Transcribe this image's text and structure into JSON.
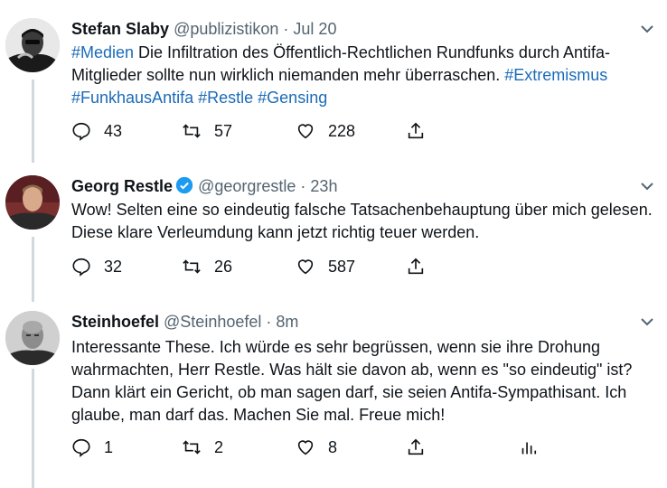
{
  "tweets": [
    {
      "name": "Stefan Slaby",
      "handle": "@publizistikon",
      "sep": "·",
      "time": "Jul 20",
      "text": [
        {
          "t": "#Medien",
          "tag": true
        },
        {
          "t": " Die Infiltration des Öffentlich-Rechtlichen Rundfunks durch Antifa-Mitglieder sollte nun wirklich niemanden mehr überraschen. ",
          "tag": false
        },
        {
          "t": "#Extremismus",
          "tag": true
        },
        {
          "t": " ",
          "tag": false
        },
        {
          "t": "#FunkhausAntifa",
          "tag": true
        },
        {
          "t": " ",
          "tag": false
        },
        {
          "t": "#Restle",
          "tag": true
        },
        {
          "t": " ",
          "tag": false
        },
        {
          "t": "#Gensing",
          "tag": true
        }
      ],
      "replies": "43",
      "retweets": "57",
      "likes": "228"
    },
    {
      "name": "Georg Restle",
      "handle": "@georgrestle",
      "sep": "·",
      "time": "23h",
      "verified": true,
      "text_plain": "Wow! Selten eine so eindeutig falsche Tatsachenbehauptung über mich gelesen. Diese klare Verleumdung kann jetzt richtig teuer werden.",
      "replies": "32",
      "retweets": "26",
      "likes": "587"
    },
    {
      "name": "Steinhoefel",
      "handle": "@Steinhoefel",
      "sep": "·",
      "time": "8m",
      "text_plain": "Interessante These. Ich würde es sehr begrüssen, wenn sie ihre Drohung wahrmachten, Herr Restle. Was hält sie davon ab, wenn es \"so eindeutig\" ist? Dann klärt ein Gericht, ob man sagen darf, sie seien Antifa-Sympathisant. Ich glaube, man darf das. Machen Sie mal. Freue mich!",
      "replies": "1",
      "retweets": "2",
      "likes": "8"
    }
  ],
  "colors": {
    "hashtag": "#1b6bb8",
    "verified": "#1d9bf0",
    "muted": "#536471",
    "thread_line": "#cfd9de"
  }
}
